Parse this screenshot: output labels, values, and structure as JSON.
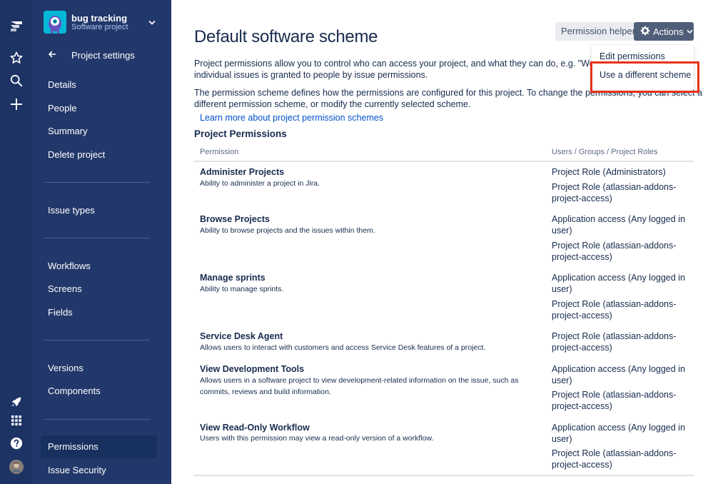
{
  "project": {
    "name": "bug tracking",
    "type": "Software project"
  },
  "sidebar": {
    "title": "Project settings",
    "items": [
      {
        "label": "Details"
      },
      {
        "label": "People"
      },
      {
        "label": "Summary"
      },
      {
        "label": "Delete project"
      },
      {
        "label": "Issue types"
      },
      {
        "label": "Workflows"
      },
      {
        "label": "Screens"
      },
      {
        "label": "Fields"
      },
      {
        "label": "Versions"
      },
      {
        "label": "Components"
      },
      {
        "label": "Permissions"
      },
      {
        "label": "Issue Security"
      }
    ],
    "active": "Permissions"
  },
  "global_nav": {
    "icons": [
      "jira-logo-icon",
      "star-icon",
      "search-icon",
      "create-plus-icon",
      "rocket-icon",
      "app-switcher-icon",
      "help-icon",
      "user-avatar"
    ]
  },
  "page": {
    "title": "Default software scheme",
    "helper_button": "Permission helper",
    "actions_button": "Actions",
    "desc1_line1": "Project permissions allow you to control who can access your project, and what they can do, e.g. \"Work on",
    "desc1_line2": "individual issues is granted to people by issue permissions.",
    "desc2_line1": "The permission scheme defines how the permissions are configured for this project. To change the permissions, you can select a",
    "desc2_line2": "different permission scheme, or modify the currently selected scheme.",
    "learn_more": "Learn more about project permission schemes",
    "section_title": "Project Permissions"
  },
  "dropdown": {
    "items": [
      "Edit permissions",
      "Use a different scheme"
    ]
  },
  "table": {
    "headers": [
      "Permission",
      "Users / Groups / Project Roles"
    ],
    "rows": [
      {
        "name": "Administer Projects",
        "desc": "Ability to administer a project in Jira.",
        "grants": [
          "Project Role (Administrators)",
          "Project Role (atlassian-addons-project-access)"
        ]
      },
      {
        "name": "Browse Projects",
        "desc": "Ability to browse projects and the issues within them.",
        "grants": [
          "Application access (Any logged in user)",
          "Project Role (atlassian-addons-project-access)"
        ]
      },
      {
        "name": "Manage sprints",
        "desc": "Ability to manage sprints.",
        "grants": [
          "Application access (Any logged in user)",
          "Project Role (atlassian-addons-project-access)"
        ]
      },
      {
        "name": "Service Desk Agent",
        "desc": "Allows users to interact with customers and access Service Desk features of a project.",
        "grants": [
          "Project Role (atlassian-addons-project-access)"
        ]
      },
      {
        "name": "View Development Tools",
        "desc": "Allows users in a software project to view development-related information on the issue, such as commits, reviews and build information.",
        "grants": [
          "Application access (Any logged in user)",
          "Project Role (atlassian-addons-project-access)"
        ]
      },
      {
        "name": "View Read-Only Workflow",
        "desc": "Users with this permission may view a read-only version of a workflow.",
        "grants": [
          "Application access (Any logged in user)",
          "Project Role (atlassian-addons-project-access)"
        ]
      }
    ]
  }
}
